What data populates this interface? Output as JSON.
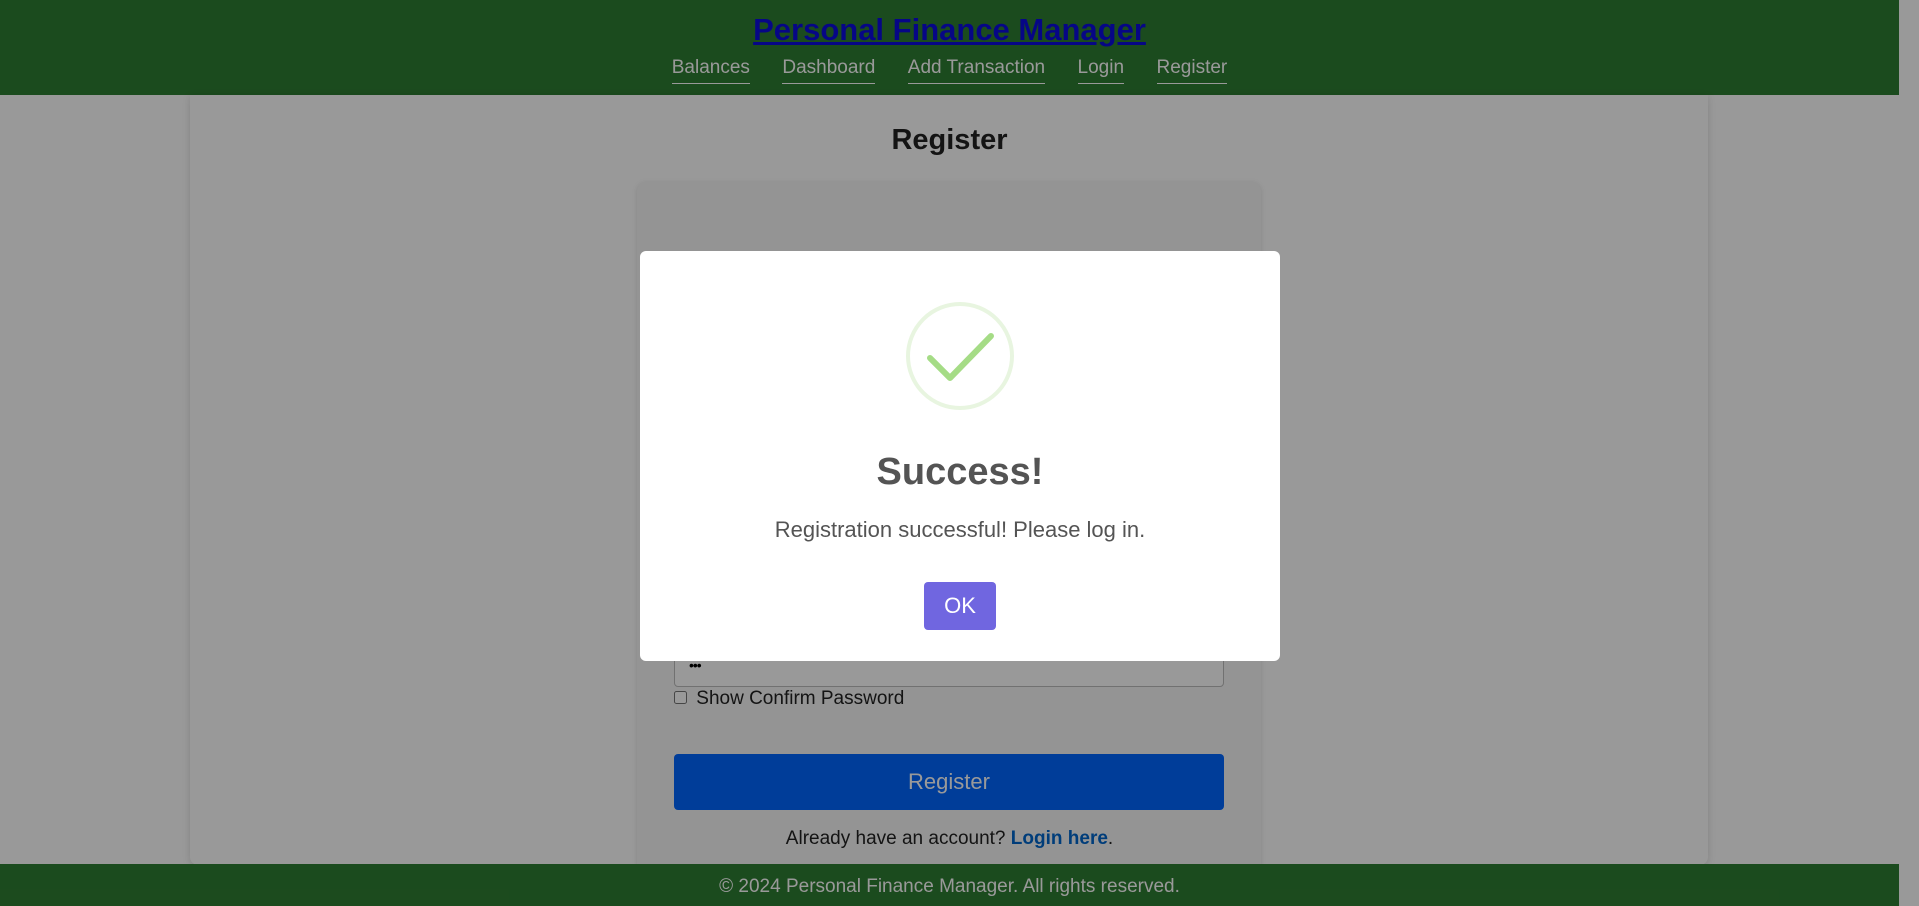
{
  "header": {
    "title": "Personal Finance Manager",
    "nav": [
      "Balances",
      "Dashboard",
      "Add Transaction",
      "Login",
      "Register"
    ]
  },
  "register_form": {
    "title": "Register",
    "password_mask": "•••",
    "show_confirm_password_label": "Show Confirm Password",
    "submit_label": "Register",
    "login_prompt": "Already have an account?",
    "login_link": "Login here",
    "login_suffix": "."
  },
  "modal": {
    "icon": "success-checkmark-icon",
    "title": "Success!",
    "message": "Registration successful! Please log in.",
    "ok_label": "OK"
  },
  "footer": {
    "text": "© 2024 Personal Finance Manager. All rights reserved."
  },
  "colors": {
    "header_bg": "#2e7d32",
    "primary_button": "#0066ff",
    "modal_button": "#7066e0",
    "success_icon": "#a5dc86"
  }
}
